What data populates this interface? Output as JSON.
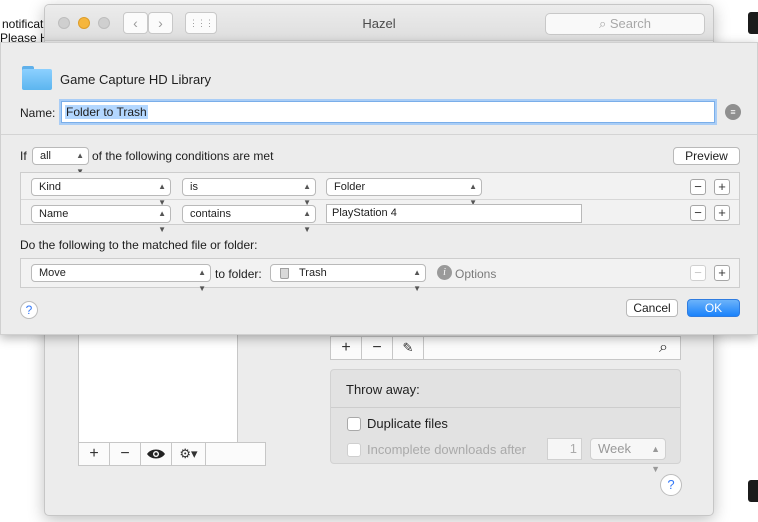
{
  "background": {
    "line1": "notificati",
    "line2": "Please H"
  },
  "hazel": {
    "title": "Hazel",
    "search_placeholder": "Search",
    "nav_back": "‹",
    "nav_forward": "›",
    "grid_icon": "⋮⋮⋮",
    "list_bar": {
      "add": "+",
      "remove": "−",
      "gear": "⚙▾"
    },
    "rule_bar": {
      "add": "+",
      "remove": "−",
      "edit": "✎",
      "search": "⌕"
    },
    "throw_away": {
      "title": "Throw away:",
      "duplicate_files": "Duplicate files",
      "incomplete_downloads": "Incomplete downloads after",
      "count": "1",
      "unit": "Week"
    },
    "help": "?"
  },
  "sheet": {
    "folder_name": "Game Capture HD Library",
    "name_label": "Name:",
    "name_value": "Folder to Trash",
    "if_label": "If",
    "match_mode": "all",
    "conditions_text": "of the following conditions are met",
    "preview_label": "Preview",
    "conditions": [
      {
        "attribute": "Kind",
        "operator": "is",
        "value": "Folder"
      },
      {
        "attribute": "Name",
        "operator": "contains",
        "value": "PlayStation 4"
      }
    ],
    "do_label": "Do the following to the matched file or folder:",
    "action": {
      "type": "Move",
      "to_folder_label": "to folder:",
      "folder": "Trash",
      "options_label": "Options"
    },
    "cancel_label": "Cancel",
    "ok_label": "OK",
    "help": "?",
    "plus": "+",
    "minus": "−",
    "updown": "⬍"
  },
  "colors": {
    "accent": "#1a82fb",
    "folder": "#5cb5ef",
    "sheet_bg": "#ececec"
  }
}
